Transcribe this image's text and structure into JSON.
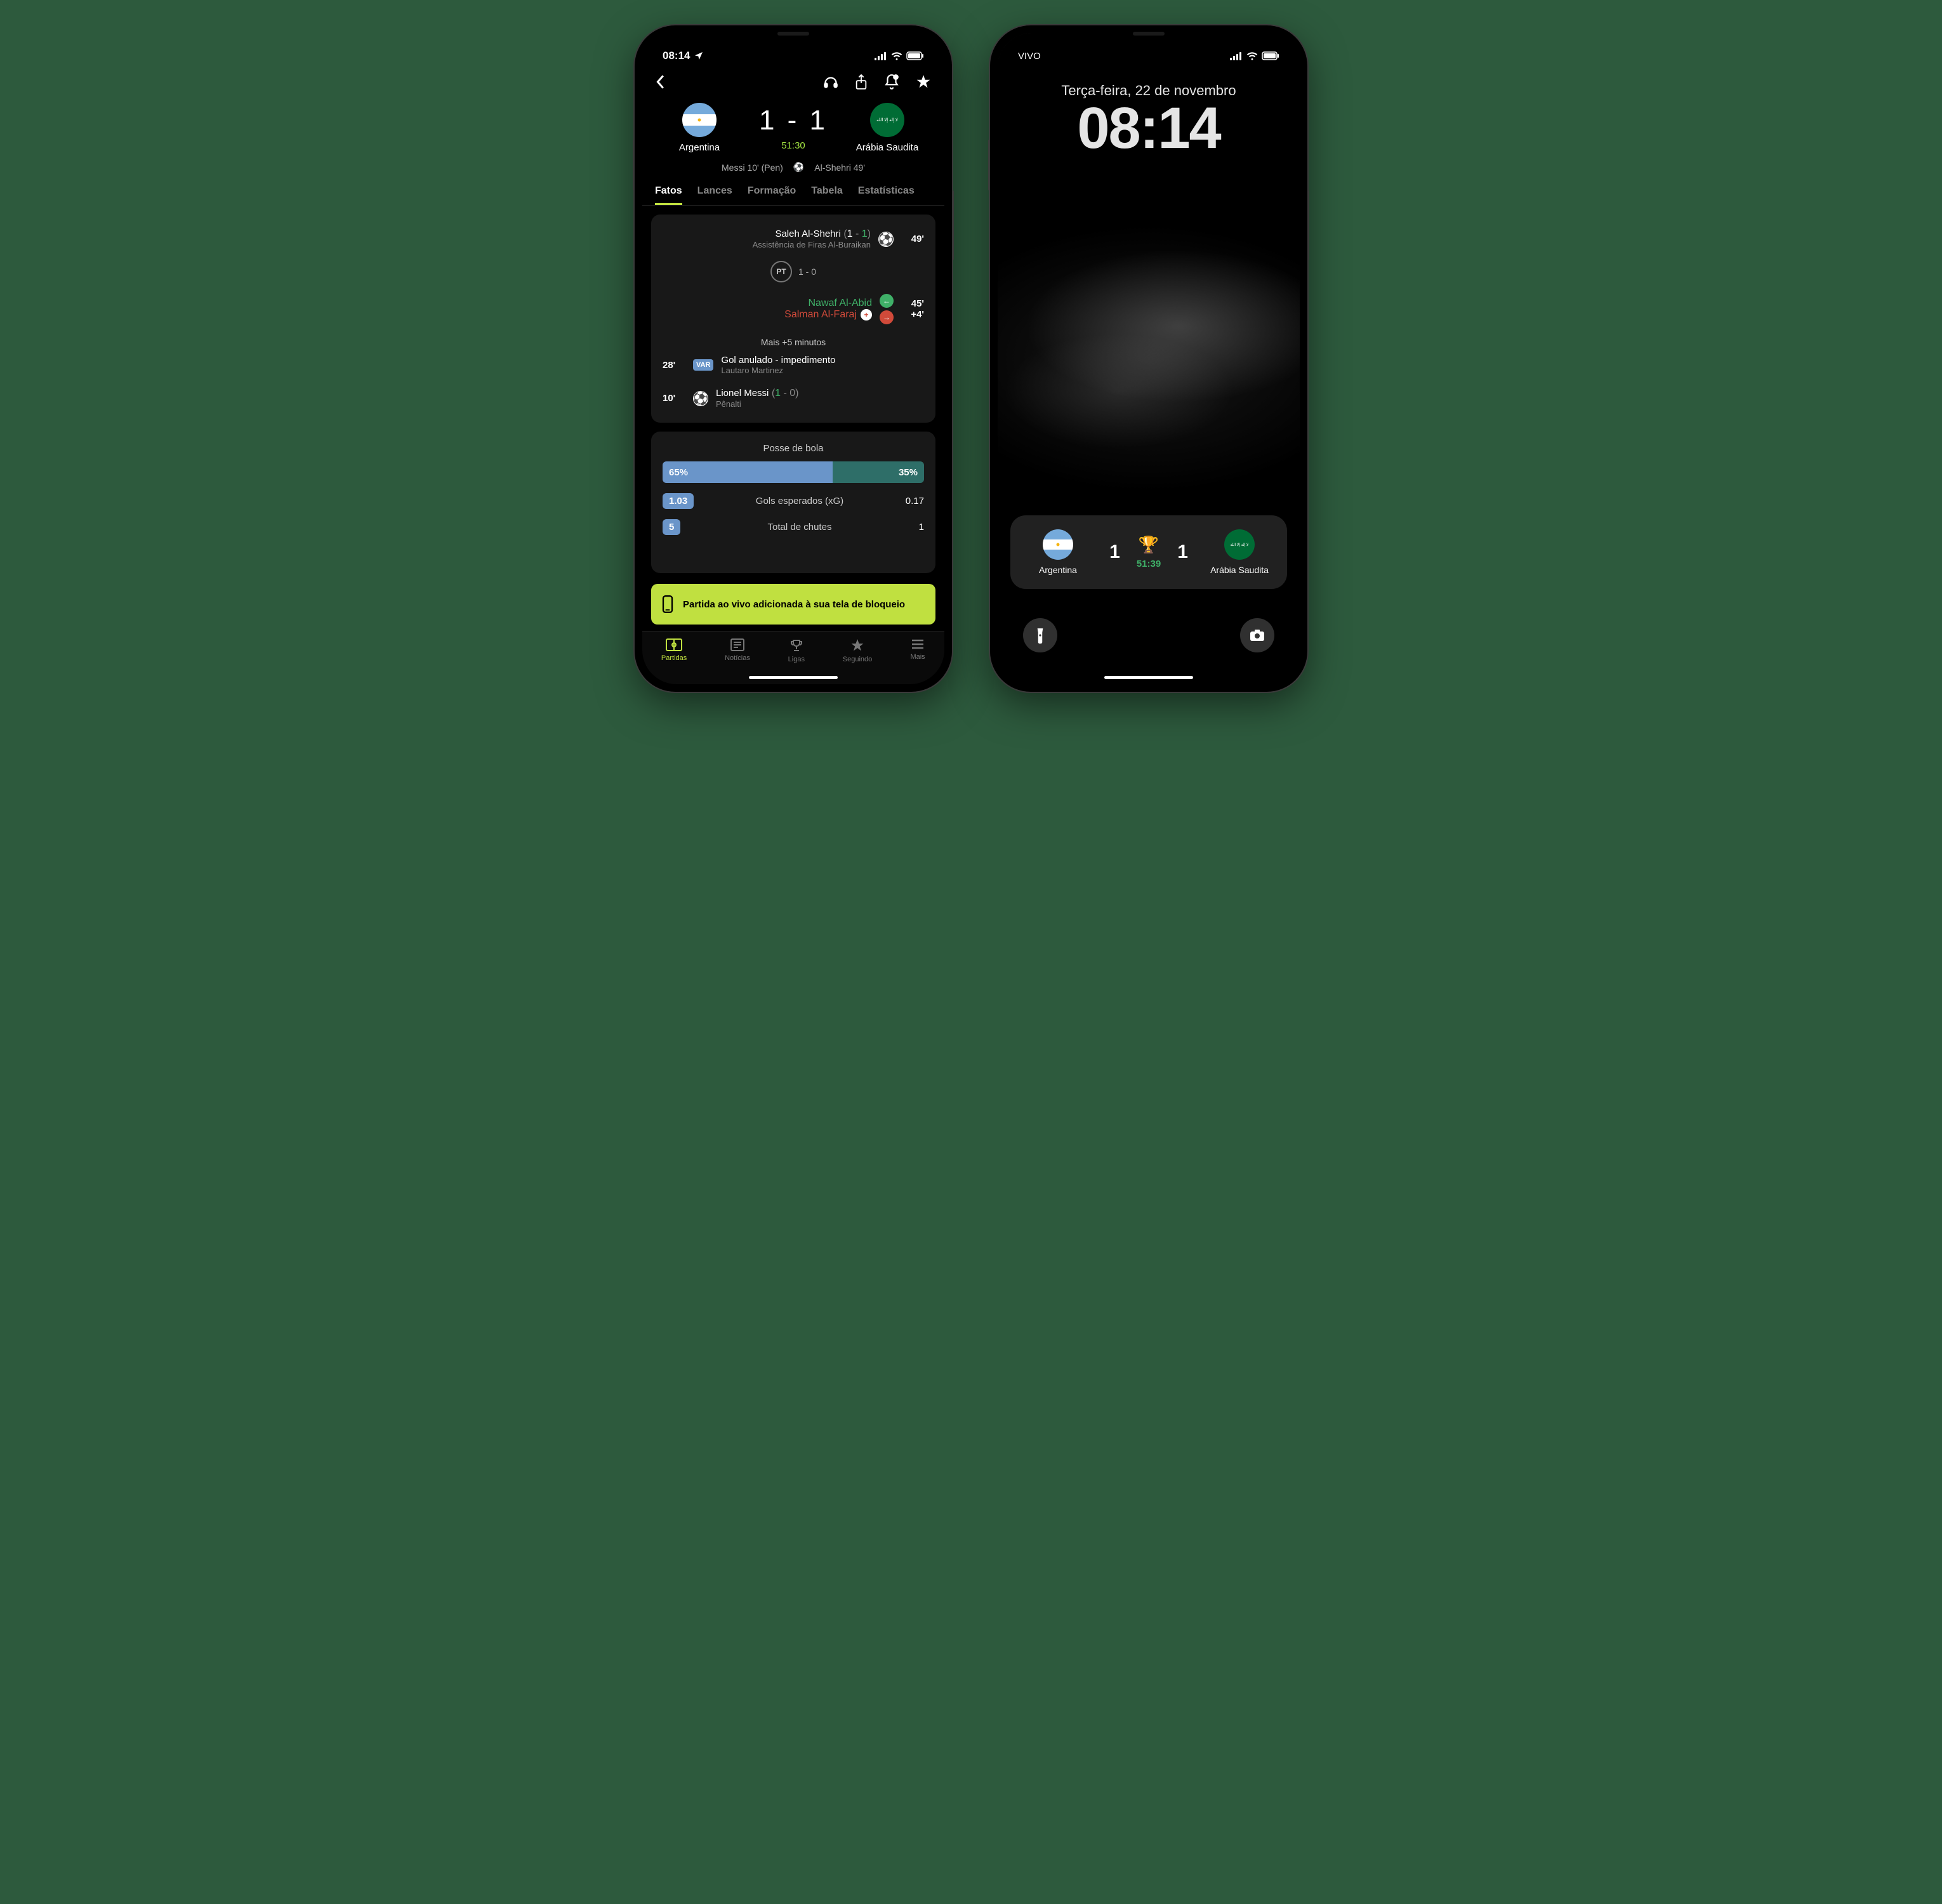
{
  "phone1": {
    "status": {
      "time": "08:14",
      "carrier": ""
    },
    "header": {},
    "match": {
      "home": {
        "name": "Argentina",
        "score": "1"
      },
      "away": {
        "name": "Arábia Saudita",
        "score": "1"
      },
      "score_display": "1 - 1",
      "clock": "51:30",
      "scorers_left": "Messi 10' (Pen)",
      "scorers_right": "Al-Shehri 49'"
    },
    "tabs": [
      "Fatos",
      "Lances",
      "Formação",
      "Tabela",
      "Estatísticas"
    ],
    "timeline": {
      "goal_away": {
        "player": "Saleh Al-Shehri",
        "score": "(1 - 1)",
        "assist": "Assistência de Firas Al-Buraikan",
        "time": "49'"
      },
      "ht": {
        "label": "PT",
        "score": "1 - 0"
      },
      "sub": {
        "in": "Nawaf Al-Abid",
        "out": "Salman Al-Faraj",
        "time_in": "45'",
        "time_out": "+4'"
      },
      "extra": "Mais +5 minutos",
      "var": {
        "time": "28'",
        "tag": "VAR",
        "title": "Gol anulado - impedimento",
        "player": "Lautaro Martinez"
      },
      "goal_home": {
        "time": "10'",
        "player": "Lionel Messi",
        "score": "(1 - 0)",
        "note": "Pênalti"
      }
    },
    "stats": {
      "possession_title": "Posse de bola",
      "poss_left": "65%",
      "poss_right": "35%",
      "xg_label": "Gols esperados (xG)",
      "xg_home": "1.03",
      "xg_away": "0.17",
      "shots_label": "Total de chutes",
      "shots_home": "5",
      "shots_away": "1"
    },
    "toast": "Partida ao vivo adicionada à sua tela de bloqueio",
    "nav": [
      "Partidas",
      "Notícias",
      "Ligas",
      "Seguindo",
      "Mais"
    ]
  },
  "phone2": {
    "status": {
      "carrier": "VIVO"
    },
    "lock": {
      "date": "Terça-feira, 22 de novembro",
      "time": "08:14"
    },
    "widget": {
      "home": {
        "name": "Argentina",
        "score": "1"
      },
      "away": {
        "name": "Arábia Saudita",
        "score": "1"
      },
      "clock": "51:39"
    }
  },
  "chart_data": {
    "type": "bar",
    "title": "Posse de bola",
    "categories": [
      "Argentina",
      "Arábia Saudita"
    ],
    "values": [
      65,
      35
    ],
    "xlabel": "",
    "ylabel": "%",
    "ylim": [
      0,
      100
    ]
  }
}
